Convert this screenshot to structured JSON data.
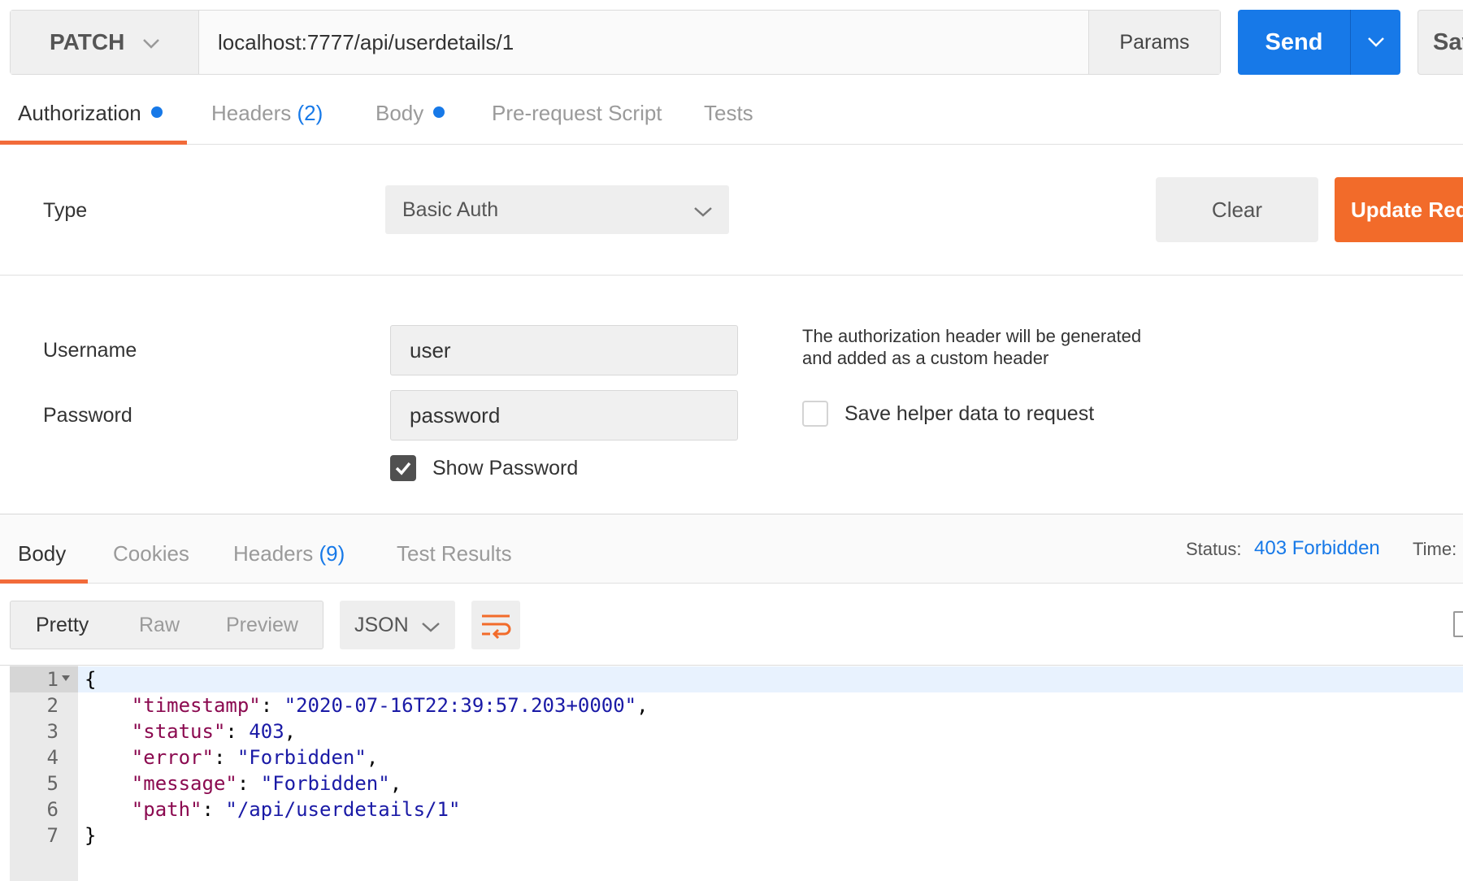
{
  "request": {
    "method": "PATCH",
    "url": "localhost:7777/api/userdetails/1",
    "params_label": "Params",
    "send_label": "Send",
    "save_label": "Sav"
  },
  "request_tabs": {
    "authorization": "Authorization",
    "headers": "Headers",
    "headers_count": "(2)",
    "body": "Body",
    "prerequest": "Pre-request Script",
    "tests": "Tests"
  },
  "auth": {
    "type_label": "Type",
    "type_value": "Basic Auth",
    "clear_label": "Clear",
    "update_label": "Update Requ",
    "username_label": "Username",
    "username_value": "user",
    "password_label": "Password",
    "password_value": "password",
    "show_password_label": "Show Password",
    "show_password_checked": true,
    "hint_line1": "The authorization header will be generated",
    "hint_line2": "and added as a custom header",
    "save_helper_label": "Save helper data to request",
    "save_helper_checked": false
  },
  "response_tabs": {
    "body": "Body",
    "cookies": "Cookies",
    "headers": "Headers",
    "headers_count": "(9)",
    "test_results": "Test Results",
    "status_label": "Status:",
    "status_value": "403 Forbidden",
    "time_label": "Time:"
  },
  "response_toolbar": {
    "pretty": "Pretty",
    "raw": "Raw",
    "preview": "Preview",
    "language": "JSON"
  },
  "code": {
    "line_numbers": [
      "1",
      "2",
      "3",
      "4",
      "5",
      "6",
      "7"
    ],
    "open_brace": "{",
    "close_brace": "}",
    "entries": [
      {
        "key": "\"timestamp\"",
        "value": "\"2020-07-16T22:39:57.203+0000\"",
        "comma": ","
      },
      {
        "key": "\"status\"",
        "value": "403",
        "comma": ","
      },
      {
        "key": "\"error\"",
        "value": "\"Forbidden\"",
        "comma": ","
      },
      {
        "key": "\"message\"",
        "value": "\"Forbidden\"",
        "comma": ","
      },
      {
        "key": "\"path\"",
        "value": "\"/api/userdetails/1\"",
        "comma": ""
      }
    ]
  },
  "colors": {
    "accent_blue": "#1779e8",
    "accent_orange": "#f26b2a"
  },
  "icons": {
    "method_dropdown": "chevron-down-icon",
    "send_dropdown": "chevron-down-icon",
    "type_dropdown": "chevron-down-icon",
    "language_dropdown": "chevron-down-icon",
    "wrap": "wrap-lines-icon",
    "copy": "copy-icon",
    "checkbox": "checkmark-icon"
  }
}
